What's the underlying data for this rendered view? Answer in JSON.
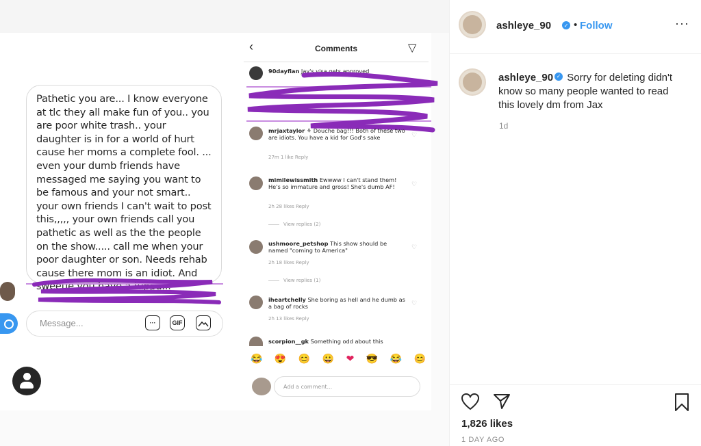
{
  "post": {
    "username": "ashleye_90",
    "verified_mark": "✓",
    "dot": "•",
    "follow_label": "Follow",
    "more": "···",
    "caption_user": "ashleye_90",
    "caption_text": "Sorry for deleting didn't know so many people wanted to read this lovely dm from Jax",
    "caption_time": "1d",
    "likes": "1,826 likes",
    "date": "1 DAY AGO",
    "icons": [
      "heart-icon",
      "share-icon",
      "bookmark-icon",
      "more-icon",
      "verified-icon"
    ],
    "accent_color": "#3897f0"
  },
  "dm": {
    "message_text": "Pathetic you are... I know everyone at tlc they all make fun of you.. you are poor white trash.. your daughter is in for a world of hurt cause her moms a complete fool. ... even your dumb friends have messaged me saying you want to be famous and your not smart.. your own friends I can't wait to post this,,,,, your own friends call you pathetic as well as the the people on the show..... call me when your poor daughter or son. Needs rehab cause there mom is an idiot. And sweetie you have a fuppa...",
    "input_placeholder": "Message...",
    "gif_label": "GIF",
    "dots_label": "···"
  },
  "comments_screen": {
    "title": "Comments",
    "back": "‹",
    "send": "▽",
    "caption_user": "90dayfian",
    "caption_text": "Jay's visa gets approved",
    "comments": [
      {
        "user": "mrjaxtaylor",
        "text": "⚘ Douche bag!!! Both of these two are idiots. You have a kid for God's sake",
        "meta": "27m   1 like   Reply"
      },
      {
        "user": "mimilewissmith",
        "text": "Ewwww I can't stand them! He's so immature and gross! She's dumb AF!",
        "meta": "2h   28 likes   Reply",
        "replies": "View replies (2)"
      },
      {
        "user": "ushmoore_petshop",
        "text": "This show should be named \"coming to America\"",
        "meta": "2h   18 likes   Reply",
        "replies": "View replies (1)"
      },
      {
        "user": "iheartchelly",
        "text": "She boring as hell and he dumb as a bag of rocks",
        "meta": "2h   13 likes   Reply"
      },
      {
        "user": "scorpion__gk",
        "text": "Something odd about this",
        "meta": ""
      }
    ],
    "emojis": [
      "😂",
      "😍",
      "😊",
      "😀",
      "❤",
      "😎",
      "😂",
      "😊"
    ],
    "add_comment_placeholder": "Add a comment..."
  }
}
